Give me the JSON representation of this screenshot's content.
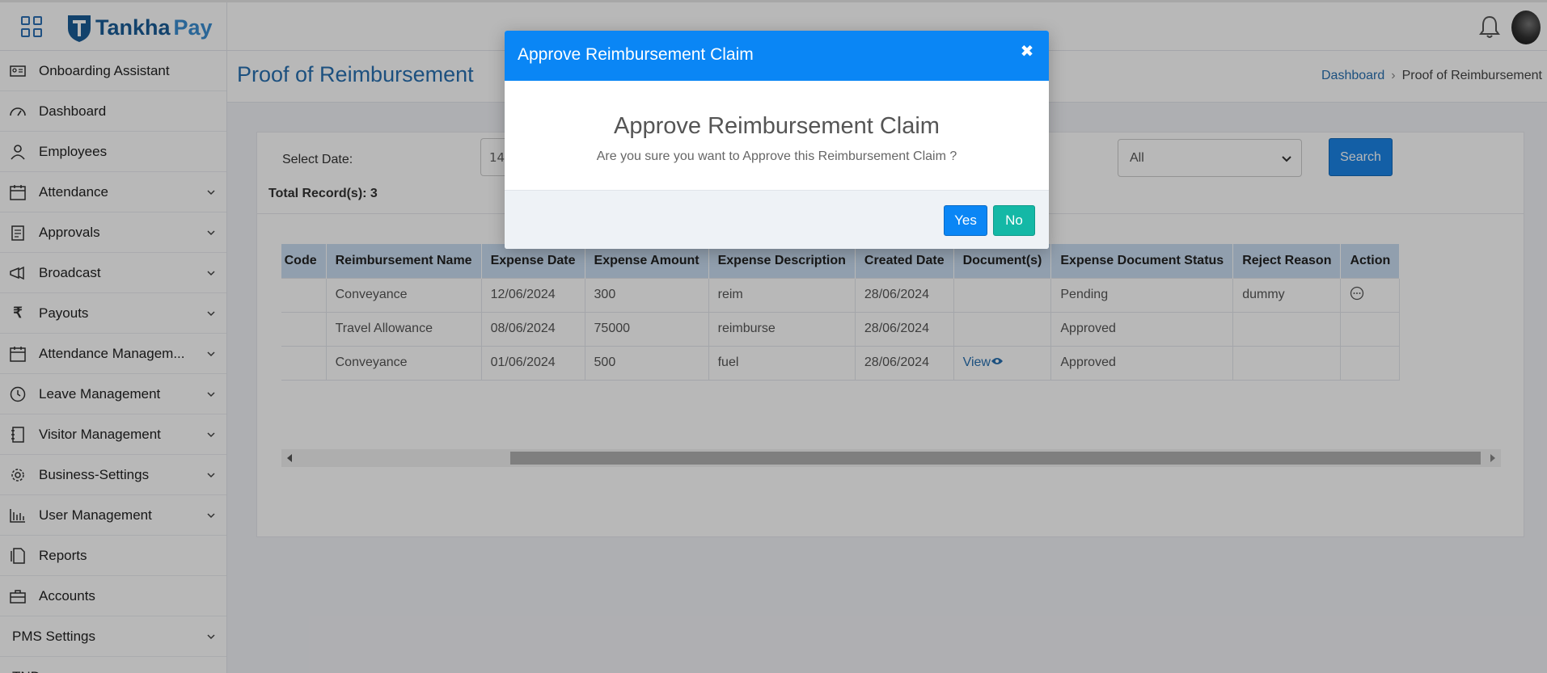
{
  "app": {
    "logo_part1": "Tankha",
    "logo_part2": "Pay"
  },
  "sidebar": {
    "items": [
      {
        "label": "Onboarding Assistant",
        "icon": "id-card-icon",
        "expandable": false
      },
      {
        "label": "Dashboard",
        "icon": "gauge-icon",
        "expandable": false
      },
      {
        "label": "Employees",
        "icon": "person-icon",
        "expandable": false
      },
      {
        "label": "Attendance",
        "icon": "calendar-icon",
        "expandable": true
      },
      {
        "label": "Approvals",
        "icon": "clipboard-icon",
        "expandable": true
      },
      {
        "label": "Broadcast",
        "icon": "megaphone-icon",
        "expandable": true
      },
      {
        "label": "Payouts",
        "icon": "rupee-icon",
        "expandable": true
      },
      {
        "label": "Attendance Managem...",
        "icon": "calendar-icon",
        "expandable": true
      },
      {
        "label": "Leave Management",
        "icon": "clock-icon",
        "expandable": true
      },
      {
        "label": "Visitor Management",
        "icon": "notebook-icon",
        "expandable": true
      },
      {
        "label": "Business-Settings",
        "icon": "gear-icon",
        "expandable": true
      },
      {
        "label": "User Management",
        "icon": "bar-chart-icon",
        "expandable": true
      },
      {
        "label": "Reports",
        "icon": "documents-icon",
        "expandable": false
      },
      {
        "label": "Accounts",
        "icon": "briefcase-icon",
        "expandable": false
      },
      {
        "label": "PMS Settings",
        "icon": "",
        "expandable": true
      },
      {
        "label": "TND",
        "icon": "",
        "expandable": false
      }
    ]
  },
  "page": {
    "title": "Proof of Reimbursement",
    "breadcrumb": {
      "home": "Dashboard",
      "current": "Proof of Reimbursement"
    }
  },
  "filters": {
    "date_label": "Select Date:",
    "date_value": "14",
    "status_select": "All",
    "search_label": "Search"
  },
  "total_records": "Total Record(s): 3",
  "table": {
    "columns": [
      "Emp Code",
      "Reimbursement Name",
      "Expense Date",
      "Expense Amount",
      "Expense Description",
      "Created Date",
      "Document(s)",
      "Expense Document Status",
      "Reject Reason",
      "Action"
    ],
    "rows": [
      [
        "",
        "Conveyance",
        "12/06/2024",
        "300",
        "reim",
        "28/06/2024",
        "",
        "Pending",
        "dummy",
        "more"
      ],
      [
        "",
        "Travel Allowance",
        "08/06/2024",
        "75000",
        "reimburse",
        "28/06/2024",
        "",
        "Approved",
        "",
        ""
      ],
      [
        "",
        "Conveyance",
        "01/06/2024",
        "500",
        "fuel",
        "28/06/2024",
        "View",
        "Approved",
        "",
        ""
      ]
    ]
  },
  "modal": {
    "header_title": "Approve Reimbursement Claim",
    "close_glyph": "✖",
    "body_title": "Approve Reimbursement Claim",
    "message": "Are you sure you want to Approve this Reimbursement Claim ?",
    "yes_label": "Yes",
    "no_label": "No"
  },
  "colors": {
    "primary": "#0a86f5",
    "teal": "#14b8a6",
    "link": "#2870b0"
  }
}
